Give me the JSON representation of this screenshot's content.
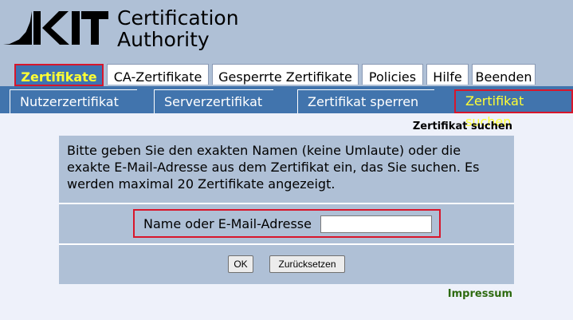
{
  "header": {
    "logo_text": "KIT",
    "title_line1": "Certification",
    "title_line2": "Authority"
  },
  "tabs": [
    {
      "label": "Zertifikate",
      "active": true
    },
    {
      "label": "CA-Zertifikate",
      "active": false
    },
    {
      "label": "Gesperrte Zertifikate",
      "active": false
    },
    {
      "label": "Policies",
      "active": false
    },
    {
      "label": "Hilfe",
      "active": false
    },
    {
      "label": "Beenden",
      "active": false
    }
  ],
  "subnav": [
    {
      "label": "Nutzerzertifikat",
      "active": false
    },
    {
      "label": "Serverzertifikat",
      "active": false
    },
    {
      "label": "Zertifikat sperren",
      "active": false
    },
    {
      "label": "Zertifikat suchen",
      "active": true
    }
  ],
  "main": {
    "section_title": "Zertifikat suchen",
    "intro_text": "Bitte geben Sie den exakten Namen (keine Umlaute) oder die exakte E-Mail-Adresse aus dem Zertifikat ein, das Sie suchen. Es werden maximal 20 Zertifikate angezeigt.",
    "field_label": "Name oder E-Mail-Adresse",
    "field_value": "",
    "ok_label": "OK",
    "reset_label": "Zurücksetzen"
  },
  "footer": {
    "impressum": "Impressum"
  },
  "colors": {
    "header_bg": "#afc0d6",
    "nav_blue": "#4174ad",
    "active_text": "#ffff33",
    "highlight_red": "#d8162b",
    "impressum_green": "#2d6a0f"
  }
}
